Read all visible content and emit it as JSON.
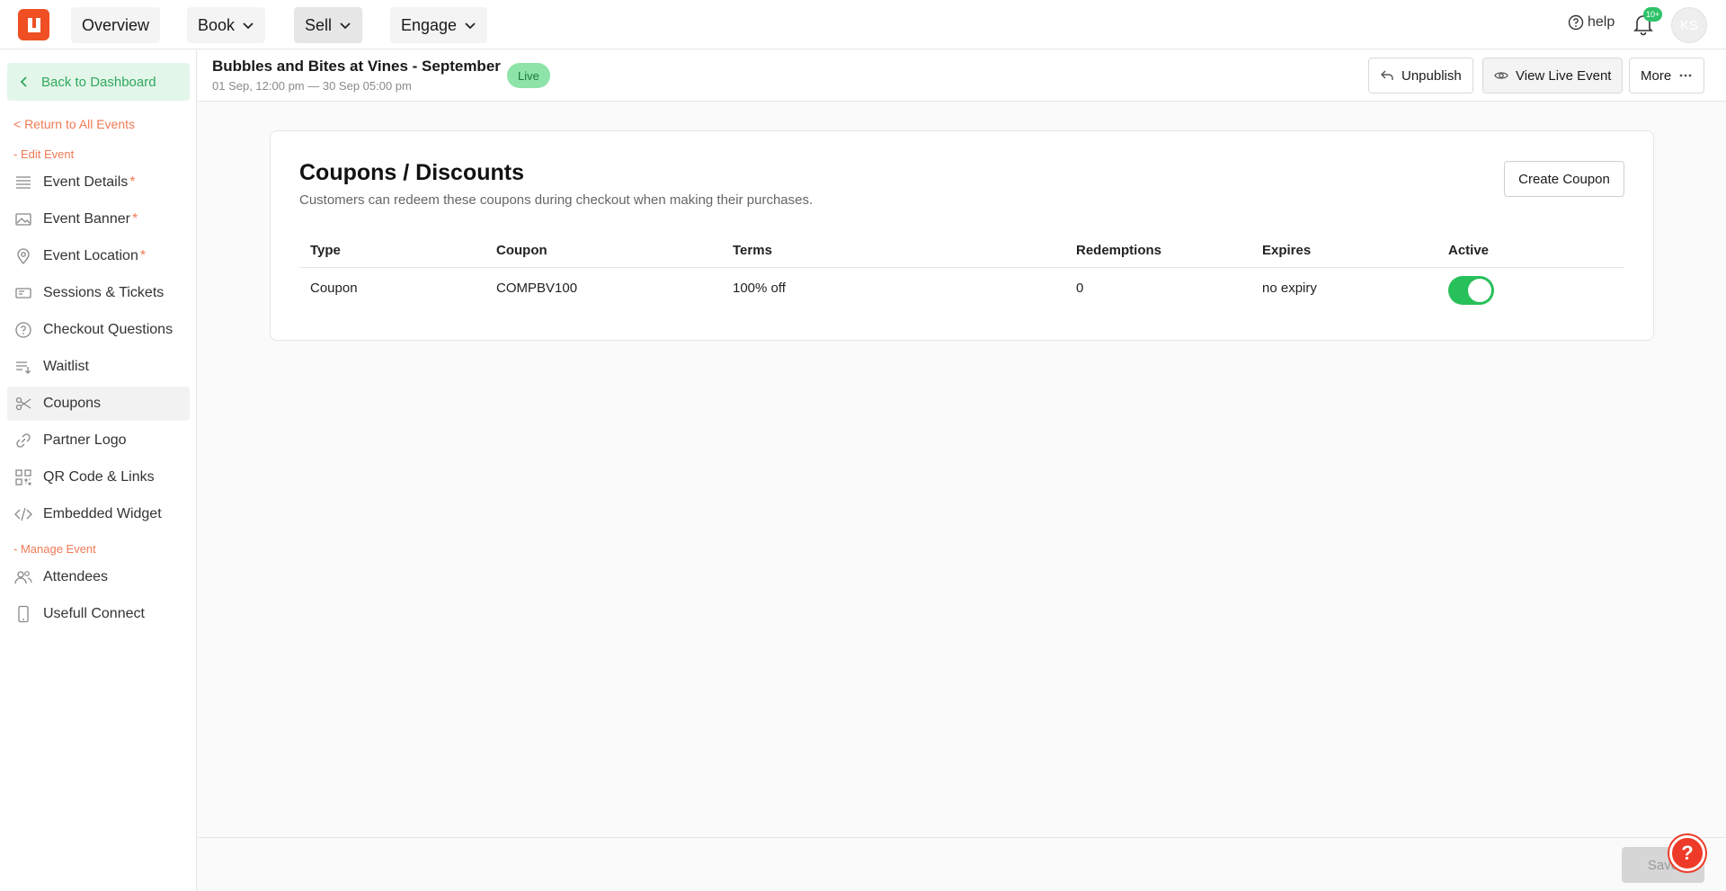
{
  "topnav": {
    "overview": "Overview",
    "book": "Book",
    "sell": "Sell",
    "engage": "Engage",
    "help": "help",
    "notif_badge": "10+",
    "avatar_initials": "KS"
  },
  "sidebar": {
    "back_dashboard": "Back to Dashboard",
    "return_events": "< Return to All Events",
    "edit_section": "- Edit Event",
    "manage_section": "- Manage Event",
    "edit_items": [
      {
        "label": "Event Details",
        "required": "*",
        "icon": "list-icon"
      },
      {
        "label": "Event Banner",
        "required": "*",
        "icon": "image-icon"
      },
      {
        "label": "Event Location",
        "required": "*",
        "icon": "location-pin-icon"
      },
      {
        "label": "Sessions & Tickets",
        "required": "",
        "icon": "ticket-icon"
      },
      {
        "label": "Checkout Questions",
        "required": "",
        "icon": "question-circle-icon"
      },
      {
        "label": "Waitlist",
        "required": "",
        "icon": "waitlist-icon"
      },
      {
        "label": "Coupons",
        "required": "",
        "icon": "scissors-icon"
      },
      {
        "label": "Partner Logo",
        "required": "",
        "icon": "link-icon"
      },
      {
        "label": "QR Code & Links",
        "required": "",
        "icon": "qr-code-icon"
      },
      {
        "label": "Embedded Widget",
        "required": "",
        "icon": "code-icon"
      }
    ],
    "manage_items": [
      {
        "label": "Attendees",
        "icon": "users-icon"
      },
      {
        "label": "Usefull Connect",
        "icon": "phone-icon"
      }
    ],
    "active_item": "Coupons"
  },
  "event": {
    "title": "Bubbles and Bites at Vines - September",
    "dates": "01 Sep, 12:00 pm — 30 Sep 05:00 pm",
    "status": "Live",
    "unpublish": "Unpublish",
    "view_live": "View Live Event",
    "more": "More"
  },
  "coupons": {
    "title": "Coupons / Discounts",
    "subtitle": "Customers can redeem these coupons during checkout when making their purchases.",
    "create_button": "Create Coupon",
    "headers": [
      "Type",
      "Coupon",
      "Terms",
      "Redemptions",
      "Expires",
      "Active"
    ],
    "rows": [
      {
        "type": "Coupon",
        "code": "COMPBV100",
        "terms": "100% off",
        "redemptions": "0",
        "expires": "no expiry",
        "active": true
      }
    ]
  },
  "footer": {
    "save": "Save",
    "help_fab": "?"
  },
  "colors": {
    "brand": "#f04e23",
    "accent_green": "#28c05a",
    "link_orange": "#f07a55"
  }
}
